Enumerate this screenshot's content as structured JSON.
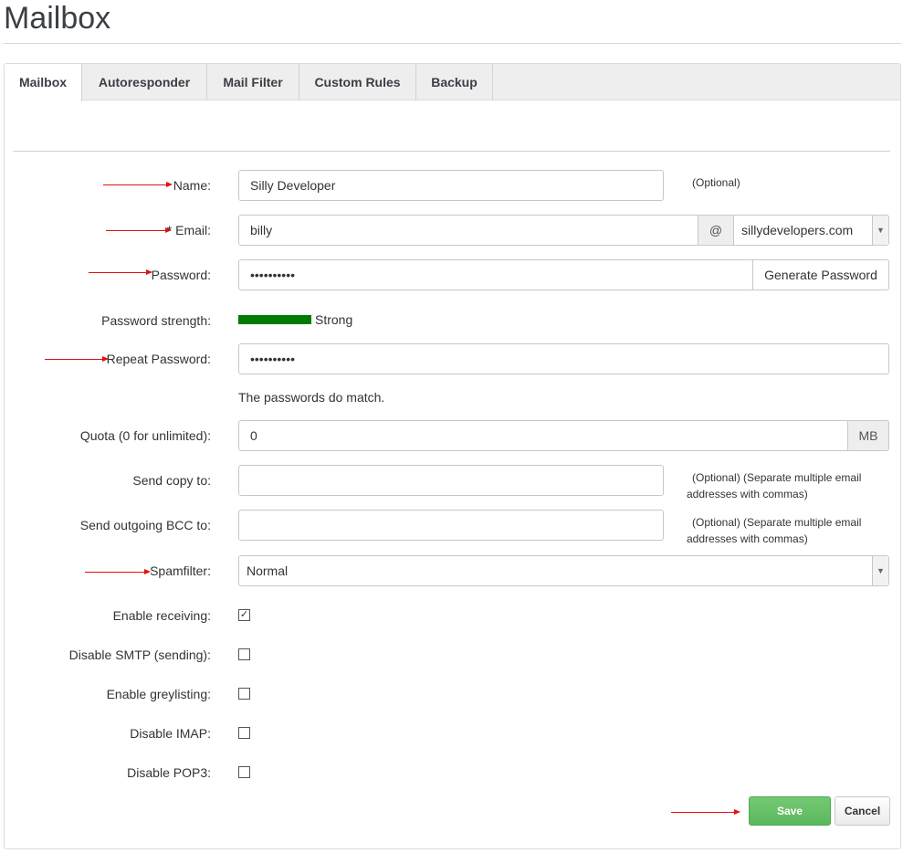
{
  "page": {
    "title": "Mailbox"
  },
  "tabs": [
    {
      "label": "Mailbox",
      "active": true
    },
    {
      "label": "Autoresponder"
    },
    {
      "label": "Mail Filter"
    },
    {
      "label": "Custom Rules"
    },
    {
      "label": "Backup"
    }
  ],
  "form": {
    "name": {
      "label": "Name:",
      "value": "Silly Developer",
      "note": "(Optional)"
    },
    "email": {
      "label": "* Email:",
      "value": "billy",
      "at": "@",
      "domain": "sillydevelopers.com"
    },
    "password": {
      "label": "Password:",
      "value": "••••••••••",
      "generate_label": "Generate Password"
    },
    "strength": {
      "label": "Password strength:",
      "value": "Strong",
      "color": "#007a00"
    },
    "repeat": {
      "label": "Repeat Password:",
      "value": "••••••••••",
      "match_text": "The passwords do match."
    },
    "quota": {
      "label": "Quota (0 for unlimited):",
      "value": "0",
      "unit": "MB"
    },
    "send_copy": {
      "label": "Send copy to:",
      "value": "",
      "note_line1": "(Optional) (Separate multiple email",
      "note_line2": "addresses with commas)"
    },
    "send_bcc": {
      "label": "Send outgoing BCC to:",
      "value": "",
      "note_line1": "(Optional) (Separate multiple email",
      "note_line2": "addresses with commas)"
    },
    "spamfilter": {
      "label": "Spamfilter:",
      "value": "Normal"
    },
    "checks": [
      {
        "label": "Enable receiving:",
        "checked": true,
        "mark": "✓"
      },
      {
        "label": "Disable SMTP (sending):",
        "checked": false,
        "mark": ""
      },
      {
        "label": "Enable greylisting:",
        "checked": false,
        "mark": ""
      },
      {
        "label": "Disable IMAP:",
        "checked": false,
        "mark": ""
      },
      {
        "label": "Disable POP3:",
        "checked": false,
        "mark": ""
      }
    ]
  },
  "buttons": {
    "save": "Save",
    "cancel": "Cancel"
  },
  "colors": {
    "annotation_arrow": "#e01010",
    "save_green": "#5cb85c"
  }
}
